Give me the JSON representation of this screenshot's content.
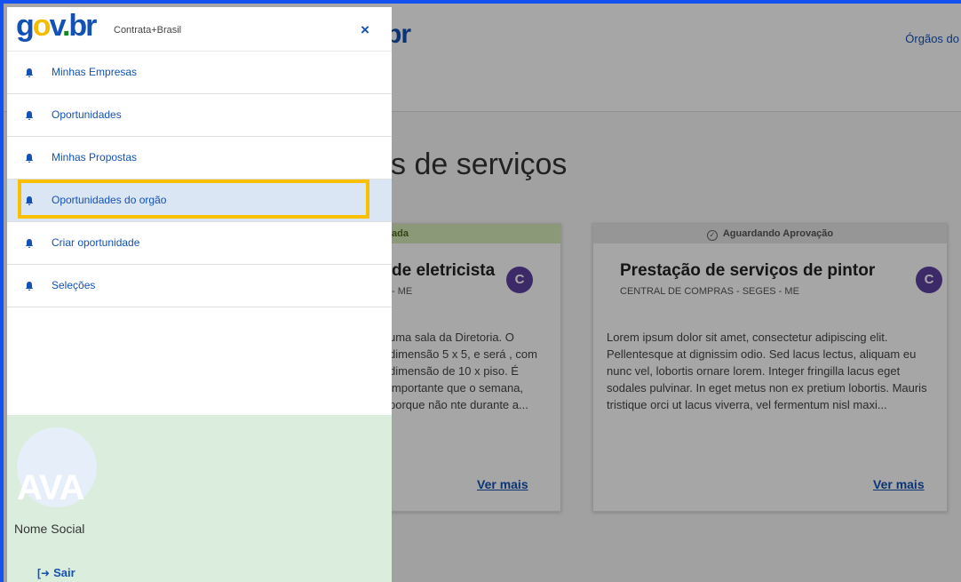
{
  "background": {
    "logo_text": "br",
    "header_link": "Órgãos do",
    "page_heading": "s de serviços",
    "cards": [
      {
        "status": "ada",
        "title": "de eletricista",
        "subtitle": "- ME",
        "avatar_letter": "C",
        "description": "uma sala da Diretoria. O dimensão 5 x 5, e será , com dimensão de 10 x piso. É importante que o semana, porque não nte durante a...",
        "link": "Ver mais"
      },
      {
        "status": "Aguardando Aprovação",
        "title": "Prestação de serviços de pintor",
        "subtitle": "CENTRAL DE COMPRAS - SEGES - ME",
        "avatar_letter": "C",
        "description": "Lorem ipsum dolor sit amet, consectetur adipiscing elit. Pellentesque at dignissim odio. Sed lacus lectus, aliquam eu nunc vel, lobortis ornare lorem. Integer fringilla lacus eget sodales pulvinar. In eget metus non ex pretium lobortis. Mauris tristique orci ut lacus viverra, vel fermentum nisl maxi...",
        "link": "Ver mais"
      }
    ]
  },
  "drawer": {
    "logo": "gov.br",
    "app_name": "Contrata+Brasil",
    "close": "×",
    "menu": [
      {
        "label": "Minhas Empresas",
        "icon": "bell-icon"
      },
      {
        "label": "Oportunidades",
        "icon": "bell-icon"
      },
      {
        "label": "Minhas Propostas",
        "icon": "bell-icon"
      },
      {
        "label": "Oportunidades do orgão",
        "icon": "bell-icon",
        "active": true
      },
      {
        "label": "Criar oportunidade",
        "icon": "bell-icon"
      },
      {
        "label": "Seleções",
        "icon": "bell-icon"
      }
    ],
    "user": {
      "avatar_text": "AVA",
      "name": "Nome Social",
      "logout": "Sair"
    }
  },
  "colors": {
    "primary": "#1351b4",
    "highlight": "#f9c000",
    "user_panel_bg": "#dbeedd",
    "frame": "#1351f0"
  }
}
